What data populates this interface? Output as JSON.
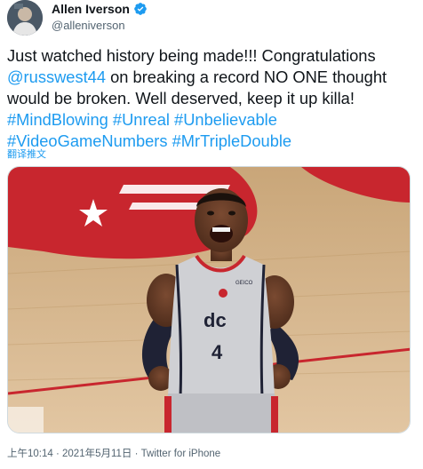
{
  "author": {
    "display_name": "Allen Iverson",
    "handle": "@alleniverson",
    "verified": true,
    "verified_icon": "verified-badge-icon"
  },
  "tweet": {
    "lines": [
      [
        {
          "text": "Just watched history being made!!! Congratulations",
          "type": "text"
        }
      ],
      [
        {
          "text": "@russwest44",
          "type": "link"
        },
        {
          "text": " on breaking a record NO ONE thought",
          "type": "text"
        }
      ],
      [
        {
          "text": "would be broken. Well deserved, keep it up killa!",
          "type": "text"
        }
      ],
      [
        {
          "text": "#MindBlowing",
          "type": "link"
        },
        {
          "text": " ",
          "type": "text"
        },
        {
          "text": "#Unreal",
          "type": "link"
        },
        {
          "text": " ",
          "type": "text"
        },
        {
          "text": "#Unbelievable",
          "type": "link"
        }
      ],
      [
        {
          "text": "#VideoGameNumbers",
          "type": "link"
        },
        {
          "text": " ",
          "type": "text"
        },
        {
          "text": "#MrTripleDouble",
          "type": "link"
        }
      ]
    ],
    "translate_label": "翻译推文"
  },
  "media": {
    "jersey_brand": "dc",
    "jersey_number": "4",
    "sponsor": "GEICO"
  },
  "meta": {
    "time": "上午10:14",
    "separator": " · ",
    "date": "2021年5月11日",
    "source": "Twitter for iPhone"
  },
  "colors": {
    "link": "#1d9bf0",
    "text": "#0f1419",
    "secondary": "#536471"
  }
}
